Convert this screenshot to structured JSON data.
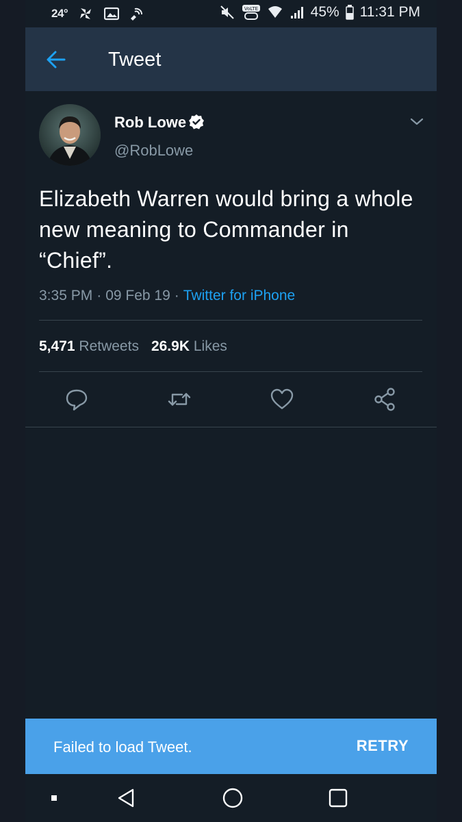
{
  "status_bar": {
    "temperature": "24°",
    "battery": "45%",
    "time": "11:31 PM",
    "lte_label": "VoLTE",
    "icons": [
      "pinwheel-icon",
      "image-icon",
      "nfc-icon",
      "mute-icon",
      "volte-icon",
      "wifi-icon",
      "signal-icon",
      "battery-icon"
    ]
  },
  "app_bar": {
    "title": "Tweet",
    "back_icon": "back-arrow-icon"
  },
  "tweet": {
    "author_name": "Rob Lowe",
    "author_handle": "@RobLowe",
    "verified_icon": "verified-badge-icon",
    "text": "Elizabeth Warren would bring a whole new meaning to Commander in “Chief”.",
    "time": "3:35 PM",
    "date": "09 Feb 19",
    "separator": "·",
    "client": "Twitter for iPhone",
    "retweets_count": "5,471",
    "retweets_label": "Retweets",
    "likes_count": "26.9K",
    "likes_label": "Likes"
  },
  "actions": [
    "reply-icon",
    "retweet-icon",
    "like-icon",
    "share-icon"
  ],
  "snackbar": {
    "message": "Failed to load Tweet.",
    "action": "RETRY"
  },
  "nav_bar": [
    "recents-dot-icon",
    "back-triangle-icon",
    "home-circle-icon",
    "overview-square-icon"
  ],
  "colors": {
    "background": "#141d26",
    "app_bar": "#243447",
    "accent": "#1da1f2",
    "secondary_text": "#8899a6",
    "snackbar": "#4aa1e9"
  }
}
